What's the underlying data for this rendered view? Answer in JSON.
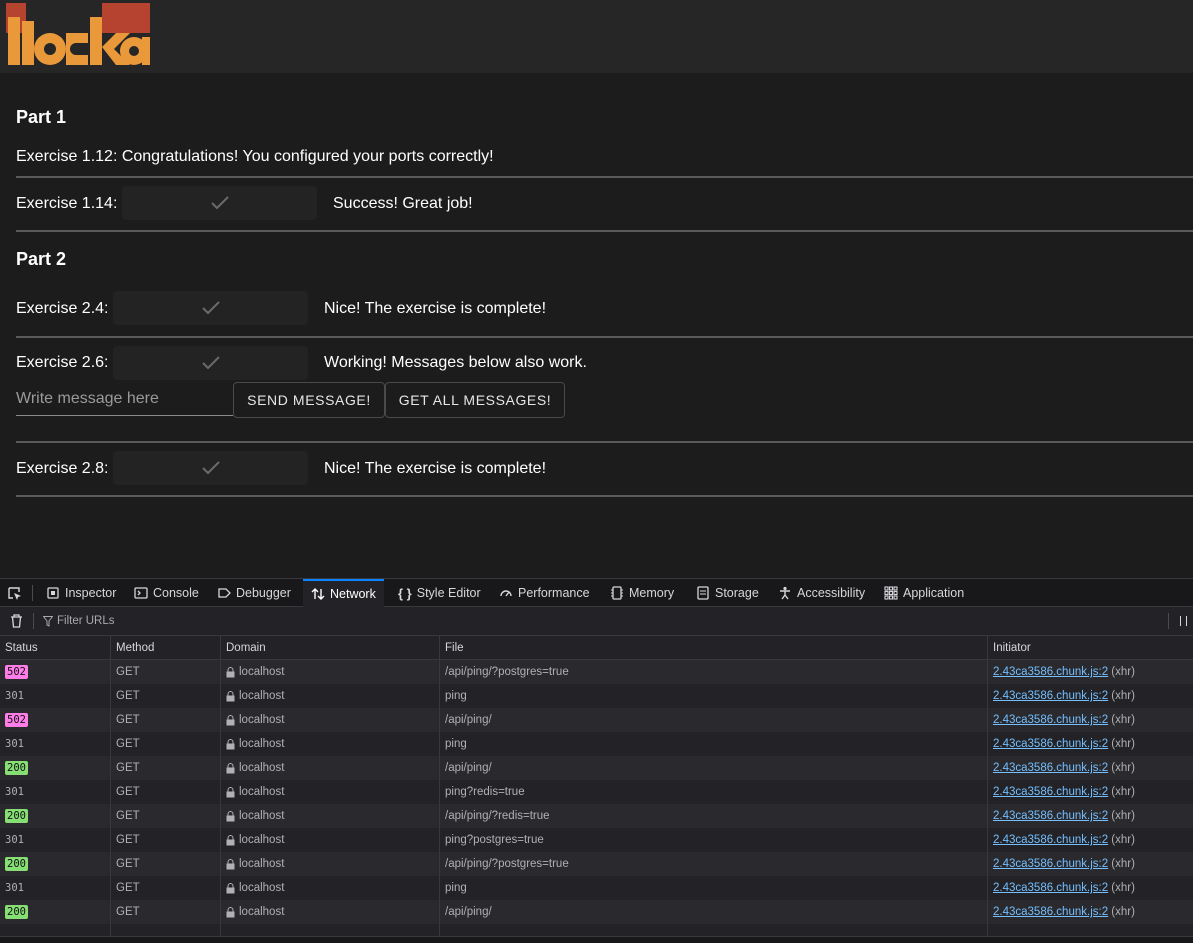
{
  "logo": {
    "text": "itoska",
    "colors": {
      "red": "#b5432f",
      "orange": "#e9993a"
    }
  },
  "part1": {
    "heading": "Part 1",
    "ex112": "Exercise 1.12: Congratulations! You configured your ports correctly!",
    "ex114_label": "Exercise 1.14:",
    "ex114_msg": "Success! Great job!"
  },
  "part2": {
    "heading": "Part 2",
    "ex24_label": "Exercise 2.4:",
    "ex24_msg": "Nice! The exercise is complete!",
    "ex26_label": "Exercise 2.6:",
    "ex26_msg": "Working! Messages below also work.",
    "message_placeholder": "Write message here",
    "send_button": "SEND MESSAGE!",
    "get_button": "GET ALL MESSAGES!",
    "ex28_label": "Exercise 2.8:",
    "ex28_msg": "Nice! The exercise is complete!"
  },
  "devtools": {
    "tabs": [
      {
        "label": "Inspector",
        "icon": "inspector-icon"
      },
      {
        "label": "Console",
        "icon": "console-icon"
      },
      {
        "label": "Debugger",
        "icon": "debugger-icon"
      },
      {
        "label": "Network",
        "icon": "network-icon",
        "active": true
      },
      {
        "label": "Style Editor",
        "icon": "style-editor-icon"
      },
      {
        "label": "Performance",
        "icon": "performance-icon"
      },
      {
        "label": "Memory",
        "icon": "memory-icon"
      },
      {
        "label": "Storage",
        "icon": "storage-icon"
      },
      {
        "label": "Accessibility",
        "icon": "accessibility-icon"
      },
      {
        "label": "Application",
        "icon": "application-icon"
      }
    ],
    "filter_placeholder": "Filter URLs",
    "columns": [
      "Status",
      "Method",
      "Domain",
      "File",
      "Initiator"
    ],
    "status_colors": {
      "502": "#ff7de9",
      "200": "#86de74"
    },
    "requests": [
      {
        "status": "502",
        "method": "GET",
        "domain": "localhost",
        "file": "/api/ping/?postgres=true",
        "initiator": "2.43ca3586.chunk.js:2",
        "type": "(xhr)"
      },
      {
        "status": "301",
        "method": "GET",
        "domain": "localhost",
        "file": "ping",
        "initiator": "2.43ca3586.chunk.js:2",
        "type": "(xhr)"
      },
      {
        "status": "502",
        "method": "GET",
        "domain": "localhost",
        "file": "/api/ping/",
        "initiator": "2.43ca3586.chunk.js:2",
        "type": "(xhr)"
      },
      {
        "status": "301",
        "method": "GET",
        "domain": "localhost",
        "file": "ping",
        "initiator": "2.43ca3586.chunk.js:2",
        "type": "(xhr)"
      },
      {
        "status": "200",
        "method": "GET",
        "domain": "localhost",
        "file": "/api/ping/",
        "initiator": "2.43ca3586.chunk.js:2",
        "type": "(xhr)"
      },
      {
        "status": "301",
        "method": "GET",
        "domain": "localhost",
        "file": "ping?redis=true",
        "initiator": "2.43ca3586.chunk.js:2",
        "type": "(xhr)"
      },
      {
        "status": "200",
        "method": "GET",
        "domain": "localhost",
        "file": "/api/ping/?redis=true",
        "initiator": "2.43ca3586.chunk.js:2",
        "type": "(xhr)"
      },
      {
        "status": "301",
        "method": "GET",
        "domain": "localhost",
        "file": "ping?postgres=true",
        "initiator": "2.43ca3586.chunk.js:2",
        "type": "(xhr)"
      },
      {
        "status": "200",
        "method": "GET",
        "domain": "localhost",
        "file": "/api/ping/?postgres=true",
        "initiator": "2.43ca3586.chunk.js:2",
        "type": "(xhr)"
      },
      {
        "status": "301",
        "method": "GET",
        "domain": "localhost",
        "file": "ping",
        "initiator": "2.43ca3586.chunk.js:2",
        "type": "(xhr)"
      },
      {
        "status": "200",
        "method": "GET",
        "domain": "localhost",
        "file": "/api/ping/",
        "initiator": "2.43ca3586.chunk.js:2",
        "type": "(xhr)"
      }
    ]
  }
}
